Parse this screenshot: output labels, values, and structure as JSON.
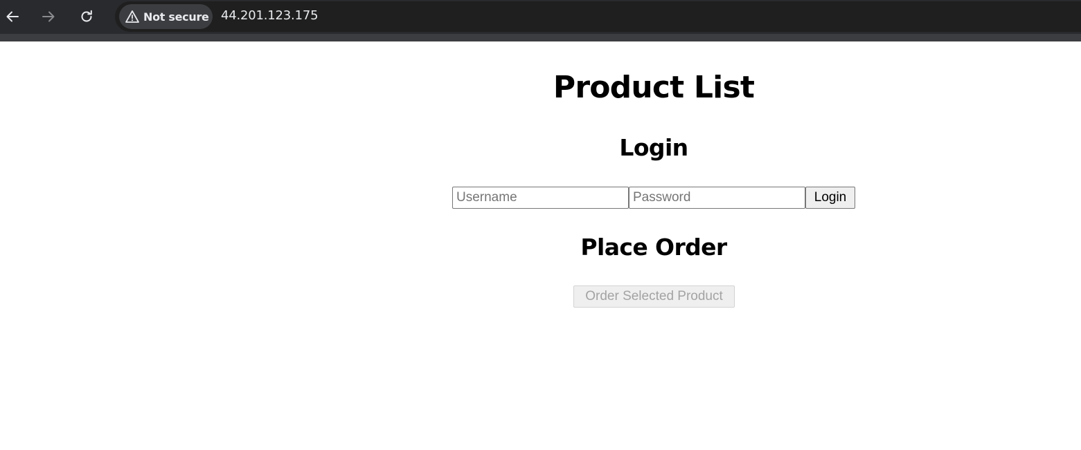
{
  "browser": {
    "security_label": "Not secure",
    "url": "44.201.123.175",
    "icons": {
      "back": "back-arrow-icon",
      "forward": "forward-arrow-icon",
      "reload": "reload-icon",
      "security": "warning-triangle-icon"
    },
    "colors": {
      "toolbar": "#292a2d",
      "text": "#e8eaed",
      "forward_disabled": "#8a8b8e"
    }
  },
  "page": {
    "title": "Product List",
    "login": {
      "heading": "Login",
      "username_placeholder": "Username",
      "password_placeholder": "Password",
      "username_value": "",
      "password_value": "",
      "submit_label": "Login"
    },
    "order": {
      "heading": "Place Order",
      "button_label": "Order Selected Product",
      "button_disabled": true
    }
  }
}
